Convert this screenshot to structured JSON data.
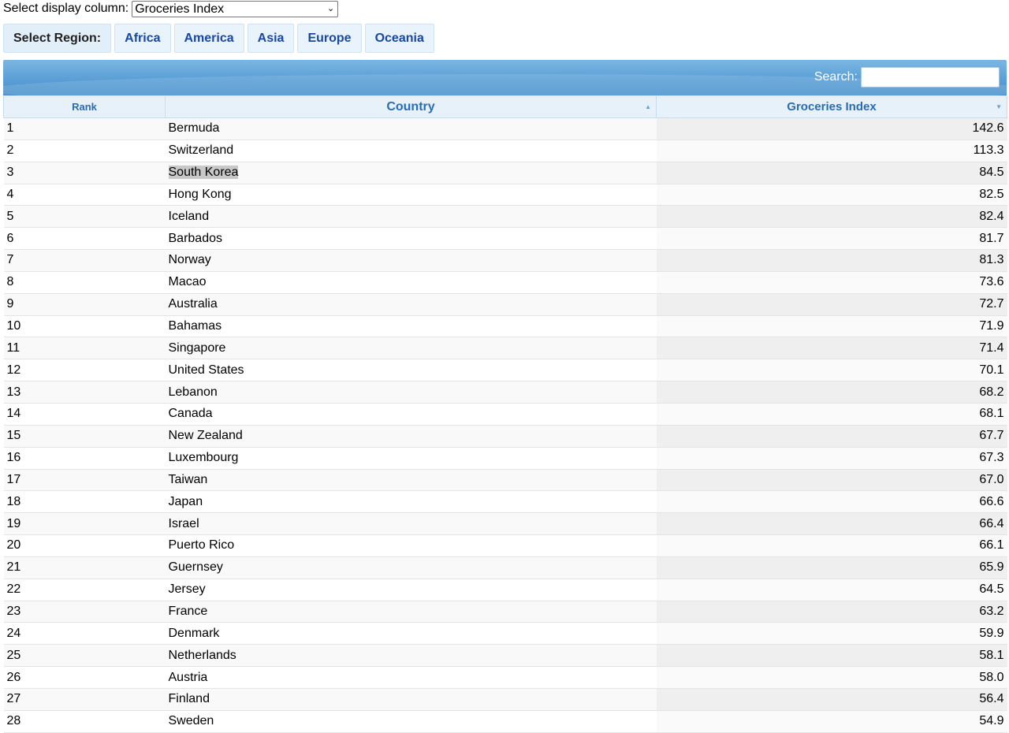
{
  "display_select": {
    "label": "Select display column:",
    "value": "Groceries Index"
  },
  "regions": {
    "label": "Select Region:",
    "items": [
      "Africa",
      "America",
      "Asia",
      "Europe",
      "Oceania"
    ]
  },
  "search": {
    "label": "Search:",
    "value": ""
  },
  "table": {
    "headers": {
      "rank": "Rank",
      "country": "Country",
      "value": "Groceries Index"
    },
    "rows": [
      {
        "rank": "1",
        "country": "Bermuda",
        "value": "142.6"
      },
      {
        "rank": "2",
        "country": "Switzerland",
        "value": "113.3"
      },
      {
        "rank": "3",
        "country": "South Korea",
        "value": "84.5"
      },
      {
        "rank": "4",
        "country": "Hong Kong",
        "value": "82.5"
      },
      {
        "rank": "5",
        "country": "Iceland",
        "value": "82.4"
      },
      {
        "rank": "6",
        "country": "Barbados",
        "value": "81.7"
      },
      {
        "rank": "7",
        "country": "Norway",
        "value": "81.3"
      },
      {
        "rank": "8",
        "country": "Macao",
        "value": "73.6"
      },
      {
        "rank": "9",
        "country": "Australia",
        "value": "72.7"
      },
      {
        "rank": "10",
        "country": "Bahamas",
        "value": "71.9"
      },
      {
        "rank": "11",
        "country": "Singapore",
        "value": "71.4"
      },
      {
        "rank": "12",
        "country": "United States",
        "value": "70.1"
      },
      {
        "rank": "13",
        "country": "Lebanon",
        "value": "68.2"
      },
      {
        "rank": "14",
        "country": "Canada",
        "value": "68.1"
      },
      {
        "rank": "15",
        "country": "New Zealand",
        "value": "67.7"
      },
      {
        "rank": "16",
        "country": "Luxembourg",
        "value": "67.3"
      },
      {
        "rank": "17",
        "country": "Taiwan",
        "value": "67.0"
      },
      {
        "rank": "18",
        "country": "Japan",
        "value": "66.6"
      },
      {
        "rank": "19",
        "country": "Israel",
        "value": "66.4"
      },
      {
        "rank": "20",
        "country": "Puerto Rico",
        "value": "66.1"
      },
      {
        "rank": "21",
        "country": "Guernsey",
        "value": "65.9"
      },
      {
        "rank": "22",
        "country": "Jersey",
        "value": "64.5"
      },
      {
        "rank": "23",
        "country": "France",
        "value": "63.2"
      },
      {
        "rank": "24",
        "country": "Denmark",
        "value": "59.9"
      },
      {
        "rank": "25",
        "country": "Netherlands",
        "value": "58.1"
      },
      {
        "rank": "26",
        "country": "Austria",
        "value": "58.0"
      },
      {
        "rank": "27",
        "country": "Finland",
        "value": "56.4"
      },
      {
        "rank": "28",
        "country": "Sweden",
        "value": "54.9"
      }
    ],
    "highlighted_country": "South Korea"
  }
}
